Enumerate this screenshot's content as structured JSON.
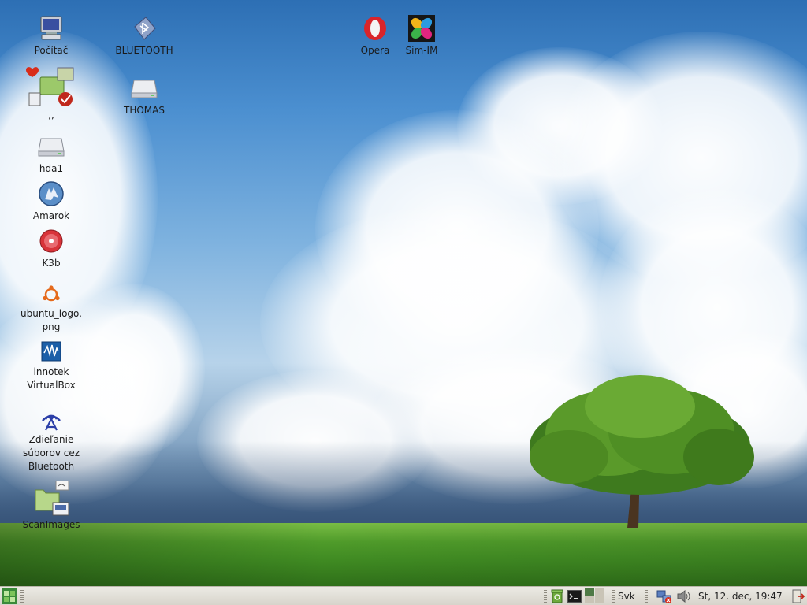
{
  "desktop": {
    "icons": [
      {
        "id": "computer",
        "label": "Počítač",
        "icon": "computer-icon"
      },
      {
        "id": "bluetooth-file",
        "label": "BLUETOOTH",
        "icon": "bluetooth-file-icon"
      },
      {
        "id": "bundle",
        "label": ",,",
        "icon": "folder-bundle-icon"
      },
      {
        "id": "thomas",
        "label": "THOMAS",
        "icon": "drive-icon"
      },
      {
        "id": "hda1",
        "label": "hda1",
        "icon": "drive-icon"
      },
      {
        "id": "amarok",
        "label": "Amarok",
        "icon": "amarok-wolf-icon"
      },
      {
        "id": "k3b",
        "label": "K3b",
        "icon": "disc-icon"
      },
      {
        "id": "ubuntu-logo",
        "label": "ubuntu_logo.\npng",
        "icon": "ubuntu-logo-icon"
      },
      {
        "id": "virtualbox",
        "label": "innotek\nVirtualBox",
        "icon": "virtualbox-icon"
      },
      {
        "id": "bt-share",
        "label": "Zdieľanie\nsúborov cez\nBluetooth",
        "icon": "bluetooth-share-icon"
      },
      {
        "id": "scanimages",
        "label": "ScanImages",
        "icon": "folder-scan-icon"
      },
      {
        "id": "opera",
        "label": "Opera",
        "icon": "opera-icon"
      },
      {
        "id": "sim-im",
        "label": "Sim-IM",
        "icon": "sim-im-icon"
      }
    ]
  },
  "taskbar": {
    "keyboard_layout": "Svk",
    "clock": "St, 12. dec, 19:47",
    "tray_icons": [
      "recycle-icon",
      "terminal-icon",
      "pager-icon",
      "network-icon",
      "volume-icon",
      "logout-icon"
    ]
  },
  "colors": {
    "taskbar_bg": "#dcd9d0",
    "label_text": "#1a1a1a"
  }
}
